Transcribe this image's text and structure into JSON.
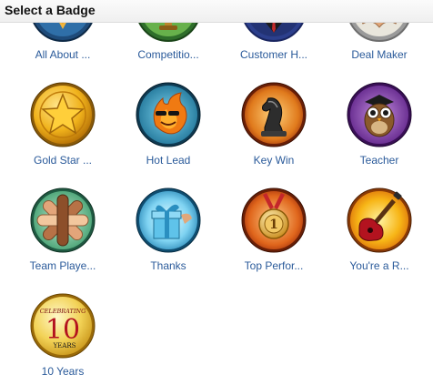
{
  "header": {
    "title": "Select a Badge"
  },
  "badges": [
    {
      "label": "All About ...",
      "icon": "all-about-icon"
    },
    {
      "label": "Competitio...",
      "icon": "trophy-icon"
    },
    {
      "label": "Customer H...",
      "icon": "customer-icon"
    },
    {
      "label": "Deal Maker",
      "icon": "handshake-icon"
    },
    {
      "label": "Gold Star ...",
      "icon": "gold-star-icon"
    },
    {
      "label": "Hot Lead",
      "icon": "hot-lead-icon"
    },
    {
      "label": "Key Win",
      "icon": "chess-knight-icon"
    },
    {
      "label": "Teacher",
      "icon": "owl-icon"
    },
    {
      "label": "Team Playe...",
      "icon": "team-hands-icon"
    },
    {
      "label": "Thanks",
      "icon": "gift-icon"
    },
    {
      "label": "Top Perfor...",
      "icon": "medal-icon"
    },
    {
      "label": "You're a R...",
      "icon": "guitar-icon"
    },
    {
      "label": "10 Years",
      "icon": "ten-years-icon"
    }
  ],
  "ten_years_badge": {
    "top_text": "CELEBRATING",
    "number": "10",
    "bottom_text": "YEARS"
  }
}
